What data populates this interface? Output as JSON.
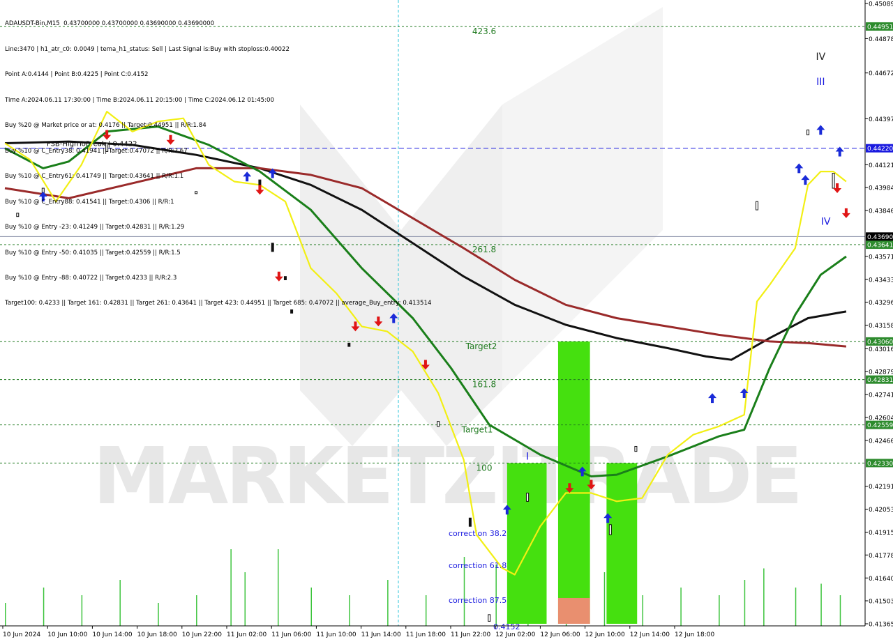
{
  "info": {
    "header": "ADAUSDT-Bin,M15  0.43700000 0.43700000 0.43690000 0.43690000",
    "lines": [
      "Line:3470 | h1_atr_c0: 0.0049 | tema_h1_status: Sell | Last Signal is:Buy with stoploss:0.40022",
      "Point A:0.4144 | Point B:0.4225 | Point C:0.4152",
      "Time A:2024.06.11 17:30:00 | Time B:2024.06.11 20:15:00 | Time C:2024.06.12 01:45:00",
      "Buy %20 @ Market price or at: 0.4176 || Target:0.44951 || R/R:1.84",
      "Buy %10 @ C_Entry38: 0.41941 || Target:0.47072 || R/R:2.67",
      "Buy %10 @ C_Entry61: 0.41749 || Target:0.43641 || R/R:1.1",
      "Buy %10 @ C_Entry88: 0.41541 || Target:0.4306 || R/R:1",
      "Buy %10 @ Entry -23: 0.41249 || Target:0.42831 || R/R:1.29",
      "Buy %10 @ Entry -50: 0.41035 || Target:0.42559 || R/R:1.5",
      "Buy %10 @ Entry -88: 0.40722 || Target:0.4233 || R/R:2.3",
      "Target100: 0.4233 || Target 161: 0.42831 || Target 261: 0.43641 || Target 423: 0.44951 || Target 685: 0.47072 || average_Buy_entry: 0.413514"
    ]
  },
  "chart_data": {
    "type": "line",
    "symbol": "ADAUSDT-Bin",
    "timeframe": "M15",
    "ylim": [
      0.41365,
      0.45089
    ],
    "y_ticks": [
      "0.45089",
      "0.44878",
      "0.44672",
      "0.44397",
      "0.44121",
      "0.43984",
      "0.43846",
      "0.43571",
      "0.43433",
      "0.43296",
      "0.43158",
      "0.43016",
      "0.42879",
      "0.42741",
      "0.42604",
      "0.42466",
      "0.42191",
      "0.42053",
      "0.41915",
      "0.41778",
      "0.41640",
      "0.41503",
      "0.41365"
    ],
    "x_labels": [
      "10 Jun 2024",
      "10 Jun 10:00",
      "10 Jun 14:00",
      "10 Jun 18:00",
      "10 Jun 22:00",
      "11 Jun 02:00",
      "11 Jun 06:00",
      "11 Jun 10:00",
      "11 Jun 14:00",
      "11 Jun 18:00",
      "11 Jun 22:00",
      "12 Jun 02:00",
      "12 Jun 06:00",
      "12 Jun 10:00",
      "12 Jun 14:00",
      "12 Jun 18:00"
    ],
    "levels": [
      {
        "price": 0.44951,
        "label": "0.44951",
        "name": "423.6",
        "color": "#1f7a1f",
        "style": "dashed"
      },
      {
        "price": 0.4422,
        "label": "0.44220",
        "name": "FSB-HighToBreak | 0.4422",
        "color": "#1a1adf",
        "style": "dashed"
      },
      {
        "price": 0.43641,
        "label": "0.43641",
        "name": "261.8",
        "color": "#1f7a1f",
        "style": "dashed"
      },
      {
        "price": 0.4306,
        "label": "0.43060",
        "name": "Target2",
        "color": "#1f7a1f",
        "style": "dashed"
      },
      {
        "price": 0.42831,
        "label": "0.42831",
        "name": "161.8",
        "color": "#1f7a1f",
        "style": "dashed"
      },
      {
        "price": 0.42559,
        "label": "0.42559",
        "name": "Target1",
        "color": "#1f7a1f",
        "style": "dashed"
      },
      {
        "price": 0.4233,
        "label": "0.42330",
        "name": "100",
        "color": "#1f7a1f",
        "style": "dashed"
      }
    ],
    "current_price": {
      "price": 0.4369,
      "label": "0.43690"
    },
    "level_text": {
      "423.6": "423.6",
      "261.8": "261.8",
      "161.8": "161.8",
      "Target1": "Target1",
      "Target2": "Target2",
      "100": "100"
    },
    "fib_zone_labels": [
      "correction 38.2",
      "correction 61.8",
      "correction 87.5",
      "0.4152"
    ],
    "wave_labels": [
      "I",
      "III",
      "IV",
      "IV"
    ],
    "watermark": "MARKETZITRADE",
    "colors": {
      "background": "#ffffff",
      "grid": "#e0e0e0",
      "level_green": "#1f7a1f",
      "level_blue": "#1a1adf",
      "ma_black": "#111111",
      "ma_brown": "#9a2a2a",
      "ma_green": "#1a7f1a",
      "tema_yellow": "#f2ef14",
      "bar_green": "#45e00f",
      "bar_salmon": "#e98f6f",
      "price_box": "#2d8b2d"
    },
    "series": [
      {
        "name": "",
        "color": "#111111",
        "points": [
          [
            0,
            0.4425
          ],
          [
            5,
            0.4426
          ],
          [
            10,
            0.4424
          ],
          [
            15,
            0.4418
          ],
          [
            20,
            0.441
          ],
          [
            24,
            0.44
          ],
          [
            28,
            0.4385
          ],
          [
            32,
            0.4365
          ],
          [
            36,
            0.4345
          ],
          [
            40,
            0.4328
          ],
          [
            44,
            0.4316
          ],
          [
            48,
            0.4308
          ],
          [
            52,
            0.4302
          ],
          [
            55,
            0.4297
          ],
          [
            57,
            0.4295
          ],
          [
            60,
            0.4308
          ],
          [
            63,
            0.432
          ],
          [
            66,
            0.4324
          ]
        ]
      },
      {
        "name": "",
        "color": "#9a2a2a",
        "points": [
          [
            0,
            0.4398
          ],
          [
            5,
            0.4392
          ],
          [
            10,
            0.4401
          ],
          [
            15,
            0.441
          ],
          [
            20,
            0.441
          ],
          [
            24,
            0.4406
          ],
          [
            28,
            0.4398
          ],
          [
            32,
            0.438
          ],
          [
            36,
            0.4362
          ],
          [
            40,
            0.4343
          ],
          [
            44,
            0.4328
          ],
          [
            48,
            0.432
          ],
          [
            52,
            0.4315
          ],
          [
            56,
            0.431
          ],
          [
            60,
            0.4306
          ],
          [
            63,
            0.4305
          ],
          [
            66,
            0.4303
          ]
        ]
      },
      {
        "name": "",
        "color": "#1a7f1a",
        "points": [
          [
            0,
            0.4422
          ],
          [
            3,
            0.441
          ],
          [
            5,
            0.4414
          ],
          [
            8,
            0.4432
          ],
          [
            12,
            0.4435
          ],
          [
            16,
            0.4424
          ],
          [
            20,
            0.4408
          ],
          [
            24,
            0.4385
          ],
          [
            28,
            0.435
          ],
          [
            32,
            0.432
          ],
          [
            35,
            0.429
          ],
          [
            38,
            0.4256
          ],
          [
            42,
            0.4238
          ],
          [
            46,
            0.4225
          ],
          [
            48,
            0.4226
          ],
          [
            52,
            0.4237
          ],
          [
            56,
            0.4249
          ],
          [
            58,
            0.4253
          ],
          [
            60,
            0.429
          ],
          [
            62,
            0.4322
          ],
          [
            64,
            0.4346
          ],
          [
            66,
            0.4357
          ]
        ]
      },
      {
        "name": "",
        "color": "#f2ef14",
        "points": [
          [
            0,
            0.4425
          ],
          [
            2,
            0.4415
          ],
          [
            4,
            0.439
          ],
          [
            6,
            0.4412
          ],
          [
            8,
            0.4444
          ],
          [
            10,
            0.4432
          ],
          [
            12,
            0.4438
          ],
          [
            14,
            0.444
          ],
          [
            16,
            0.4412
          ],
          [
            18,
            0.4402
          ],
          [
            20,
            0.44
          ],
          [
            22,
            0.439
          ],
          [
            24,
            0.435
          ],
          [
            26,
            0.4335
          ],
          [
            28,
            0.4315
          ],
          [
            30,
            0.4312
          ],
          [
            32,
            0.43
          ],
          [
            34,
            0.4275
          ],
          [
            36,
            0.4235
          ],
          [
            37,
            0.419
          ],
          [
            39,
            0.417
          ],
          [
            40,
            0.4166
          ],
          [
            42,
            0.4195
          ],
          [
            44,
            0.4215
          ],
          [
            46,
            0.4215
          ],
          [
            48,
            0.421
          ],
          [
            50,
            0.4212
          ],
          [
            52,
            0.4238
          ],
          [
            54,
            0.425
          ],
          [
            56,
            0.4255
          ],
          [
            58,
            0.4262
          ],
          [
            59,
            0.433
          ],
          [
            60,
            0.434
          ],
          [
            62,
            0.4362
          ],
          [
            63,
            0.44
          ],
          [
            64,
            0.4408
          ],
          [
            65,
            0.4408
          ],
          [
            66,
            0.4402
          ]
        ]
      }
    ],
    "candles": [
      {
        "x": 1,
        "o": 0.4381,
        "c": 0.4383
      },
      {
        "x": 3,
        "o": 0.4395,
        "c": 0.4398
      },
      {
        "x": 8,
        "o": 0.442,
        "c": 0.4425
      },
      {
        "x": 15,
        "o": 0.4395,
        "c": 0.4396
      },
      {
        "x": 20,
        "o": 0.4403,
        "c": 0.44
      },
      {
        "x": 21,
        "o": 0.4365,
        "c": 0.436
      },
      {
        "x": 22,
        "o": 0.4345,
        "c": 0.4343
      },
      {
        "x": 22.5,
        "o": 0.4325,
        "c": 0.4323
      },
      {
        "x": 27,
        "o": 0.4305,
        "c": 0.4303
      },
      {
        "x": 34,
        "o": 0.4255,
        "c": 0.4258
      },
      {
        "x": 36.5,
        "o": 0.42,
        "c": 0.4195
      },
      {
        "x": 38,
        "o": 0.4138,
        "c": 0.4142
      },
      {
        "x": 41,
        "o": 0.421,
        "c": 0.4215
      },
      {
        "x": 47.5,
        "o": 0.419,
        "c": 0.4196
      },
      {
        "x": 49.5,
        "o": 0.424,
        "c": 0.4243
      },
      {
        "x": 59,
        "o": 0.4385,
        "c": 0.439
      },
      {
        "x": 63,
        "o": 0.443,
        "c": 0.4433
      },
      {
        "x": 65,
        "o": 0.4398,
        "c": 0.4407
      }
    ],
    "volume_bars": [
      {
        "x": 0,
        "v": 0.3
      },
      {
        "x": 3,
        "v": 0.5
      },
      {
        "x": 6,
        "v": 0.4
      },
      {
        "x": 9,
        "v": 0.6
      },
      {
        "x": 12,
        "v": 0.3
      },
      {
        "x": 15,
        "v": 0.4
      },
      {
        "x": 17.7,
        "v": 1.0
      },
      {
        "x": 18.8,
        "v": 0.7
      },
      {
        "x": 21.4,
        "v": 1.0
      },
      {
        "x": 24,
        "v": 0.5
      },
      {
        "x": 27,
        "v": 0.4
      },
      {
        "x": 30,
        "v": 0.6
      },
      {
        "x": 33,
        "v": 0.4
      },
      {
        "x": 36,
        "v": 0.9
      },
      {
        "x": 38.5,
        "v": 0.8
      },
      {
        "x": 41,
        "v": 0.6
      },
      {
        "x": 44,
        "v": 0.5
      },
      {
        "x": 47,
        "v": 0.7
      },
      {
        "x": 50,
        "v": 0.4
      },
      {
        "x": 53,
        "v": 0.5
      },
      {
        "x": 56,
        "v": 0.4
      },
      {
        "x": 58,
        "v": 0.6
      },
      {
        "x": 59.5,
        "v": 0.75
      },
      {
        "x": 62,
        "v": 0.5
      },
      {
        "x": 64,
        "v": 0.55
      },
      {
        "x": 65.5,
        "v": 0.4
      }
    ],
    "fib_bars": [
      {
        "x0": 39.4,
        "x1": 42.5,
        "top": 0.4233,
        "bottom": 0.41365,
        "color": "#45e00f"
      },
      {
        "x0": 43.4,
        "x1": 45.9,
        "top": 0.4306,
        "bottom": 0.41365,
        "color": "#45e00f"
      },
      {
        "x0": 43.4,
        "x1": 45.9,
        "top": 0.4152,
        "bottom": 0.41365,
        "color": "#e98f6f"
      },
      {
        "x0": 47.2,
        "x1": 49.6,
        "top": 0.4233,
        "bottom": 0.41365,
        "color": "#45e00f"
      }
    ],
    "signals": [
      {
        "x": 3.0,
        "y": 0.4393,
        "dir": "up"
      },
      {
        "x": 8.0,
        "y": 0.443,
        "dir": "down"
      },
      {
        "x": 13.0,
        "y": 0.4427,
        "dir": "down"
      },
      {
        "x": 19.0,
        "y": 0.4405,
        "dir": "up"
      },
      {
        "x": 20.0,
        "y": 0.4397,
        "dir": "down"
      },
      {
        "x": 21.0,
        "y": 0.4407,
        "dir": "up"
      },
      {
        "x": 21.5,
        "y": 0.4345,
        "dir": "down"
      },
      {
        "x": 27.5,
        "y": 0.4315,
        "dir": "down"
      },
      {
        "x": 29.3,
        "y": 0.4318,
        "dir": "down"
      },
      {
        "x": 30.5,
        "y": 0.432,
        "dir": "up"
      },
      {
        "x": 33.0,
        "y": 0.4292,
        "dir": "down"
      },
      {
        "x": 39.4,
        "y": 0.4205,
        "dir": "up"
      },
      {
        "x": 44.3,
        "y": 0.4218,
        "dir": "down"
      },
      {
        "x": 45.3,
        "y": 0.4228,
        "dir": "up"
      },
      {
        "x": 46.0,
        "y": 0.422,
        "dir": "down"
      },
      {
        "x": 47.3,
        "y": 0.42,
        "dir": "up"
      },
      {
        "x": 55.5,
        "y": 0.4272,
        "dir": "up"
      },
      {
        "x": 58.0,
        "y": 0.4275,
        "dir": "up"
      },
      {
        "x": 62.3,
        "y": 0.441,
        "dir": "up"
      },
      {
        "x": 62.8,
        "y": 0.4403,
        "dir": "up"
      },
      {
        "x": 64.0,
        "y": 0.4433,
        "dir": "up"
      },
      {
        "x": 65.5,
        "y": 0.442,
        "dir": "up"
      },
      {
        "x": 65.3,
        "y": 0.4398,
        "dir": "down"
      },
      {
        "x": 66.0,
        "y": 0.4383,
        "dir": "down"
      }
    ],
    "wave_positions": [
      {
        "label": "I",
        "x": 41.0,
        "y": 0.4235,
        "color": "#1a1adf"
      },
      {
        "label": "III",
        "x": 64.0,
        "y": 0.446,
        "color": "#1a1adf"
      },
      {
        "label": "IV",
        "x": 64.0,
        "y": 0.4475,
        "color": "#222222"
      },
      {
        "label": "IV",
        "x": 64.4,
        "y": 0.4376,
        "color": "#1a1adf"
      }
    ]
  }
}
